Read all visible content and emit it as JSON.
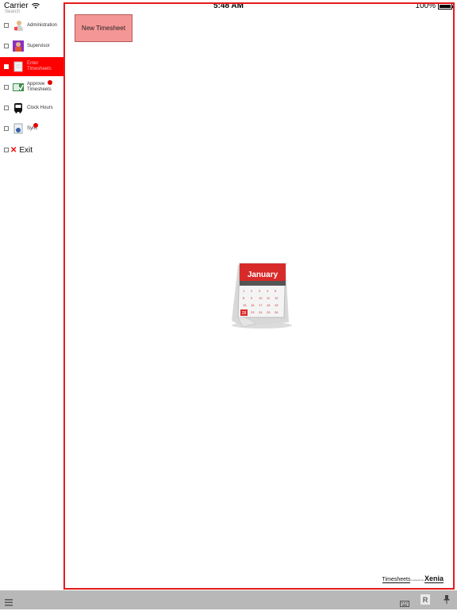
{
  "status_bar": {
    "carrier": "Carrier",
    "time": "5:48 AM",
    "battery": "100%"
  },
  "sidebar": {
    "header": "Search",
    "items": [
      {
        "label": "Administration",
        "icon": "admin-user-icon"
      },
      {
        "label": "Supervisor",
        "icon": "supervisor-icon"
      },
      {
        "label": "Enter Timesheets",
        "icon": "timesheet-doc-icon",
        "active": true
      },
      {
        "label": "Approve\nTimesheets",
        "icon": "approve-timesheets-icon",
        "badge": true
      },
      {
        "label": "Clock Hours",
        "icon": "bus-icon"
      },
      {
        "label": "Sync",
        "icon": "sync-icon",
        "badge": true
      },
      {
        "label": "Exit",
        "icon": "exit-x-icon"
      }
    ]
  },
  "main": {
    "new_button": "New Timesheet",
    "calendar": {
      "month": "January",
      "day": "28"
    },
    "footer": {
      "app": "Timesheets",
      "powered": "powered by",
      "brand": "Xenia"
    }
  },
  "colors": {
    "accent": "#ff0000",
    "button_bg": "#f59696",
    "toolbar": "#b8b8b8"
  }
}
